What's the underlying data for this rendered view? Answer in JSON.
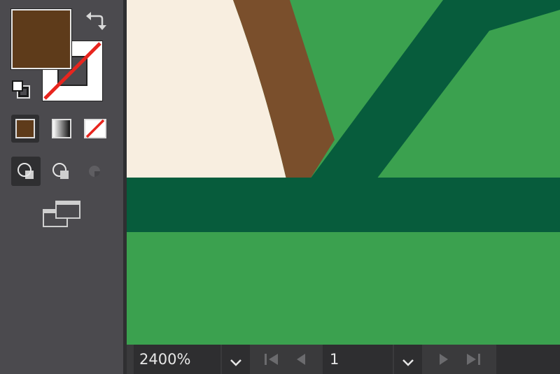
{
  "toolbar": {
    "fill_color": "#5e3b1a",
    "stroke_color": "none",
    "icons": {
      "swap": "swap-arrows-icon",
      "default_colors": "default-fill-stroke-icon",
      "color": "color-mode-icon",
      "gradient": "gradient-mode-icon",
      "none": "none-mode-icon",
      "draw_normal": "draw-normal-icon",
      "draw_behind": "draw-behind-icon",
      "draw_inside": "draw-inside-icon",
      "screen_mode": "screen-mode-icon"
    }
  },
  "canvas": {
    "colors": {
      "background_green": "#3ba14f",
      "dark_green": "#075c3c",
      "cream": "#f8eee0",
      "brown": "#7a4f2c"
    }
  },
  "statusbar": {
    "zoom": "2400%",
    "page": "1"
  }
}
